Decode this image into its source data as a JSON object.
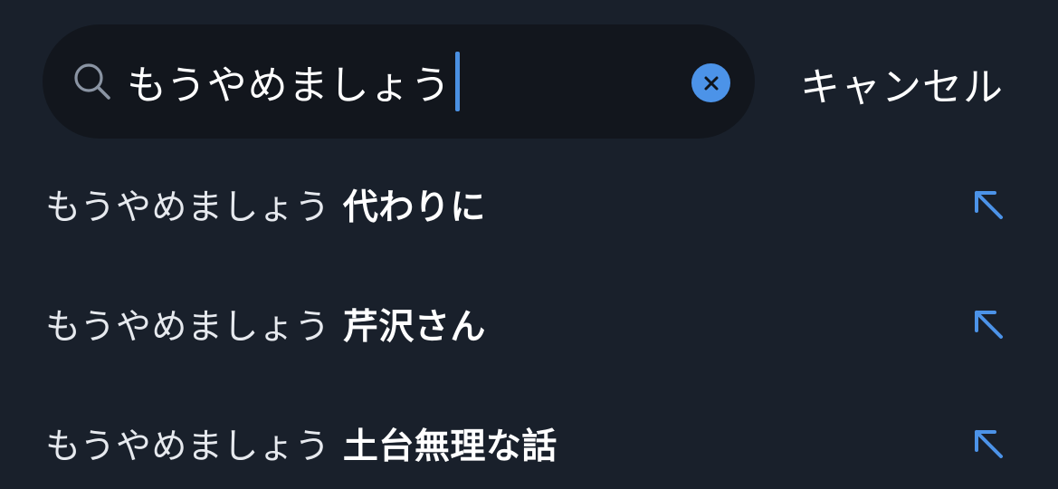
{
  "search": {
    "query": "もうやめましょう",
    "clear_icon": "close-icon",
    "search_icon": "search-icon"
  },
  "cancel_label": "キャンセル",
  "suggestions": [
    {
      "base": "もうやめましょう",
      "completion": "代わりに",
      "icon": "arrow-up-left-icon"
    },
    {
      "base": "もうやめましょう",
      "completion": "芹沢さん",
      "icon": "arrow-up-left-icon"
    },
    {
      "base": "もうやめましょう",
      "completion": "土台無理な話",
      "icon": "arrow-up-left-icon"
    }
  ],
  "colors": {
    "background": "#19202b",
    "search_field": "#12161d",
    "accent": "#4c93e8",
    "text": "#ffffff"
  }
}
